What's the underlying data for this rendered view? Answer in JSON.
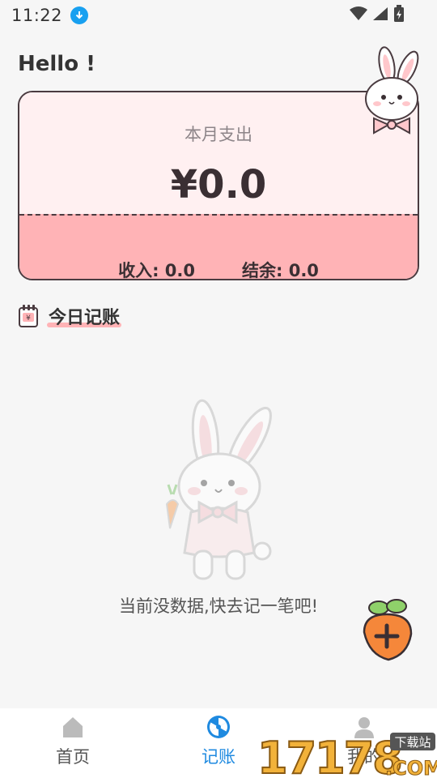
{
  "status": {
    "time": "11:22"
  },
  "greeting": "Hello !",
  "summary": {
    "label": "本月支出",
    "amount": "¥0.0",
    "income": "收入: 0.0",
    "balance": "结余: 0.0"
  },
  "section": {
    "title": "今日记账"
  },
  "empty_state": {
    "message": "当前没数据,快去记一笔吧!"
  },
  "tabs": [
    {
      "label": "首页",
      "icon": "home-icon",
      "active": false
    },
    {
      "label": "记账",
      "icon": "bookkeeping-icon",
      "active": true
    },
    {
      "label": "我的",
      "icon": "profile-icon",
      "active": false
    }
  ],
  "watermark": {
    "text": "17178",
    "badge": "下载站",
    "suffix": ".COM"
  },
  "colors": {
    "accent": "#1f8ae0",
    "card_pink": "#fff0f1",
    "card_band": "#ffb3b6",
    "fab_orange": "#f5873a"
  }
}
